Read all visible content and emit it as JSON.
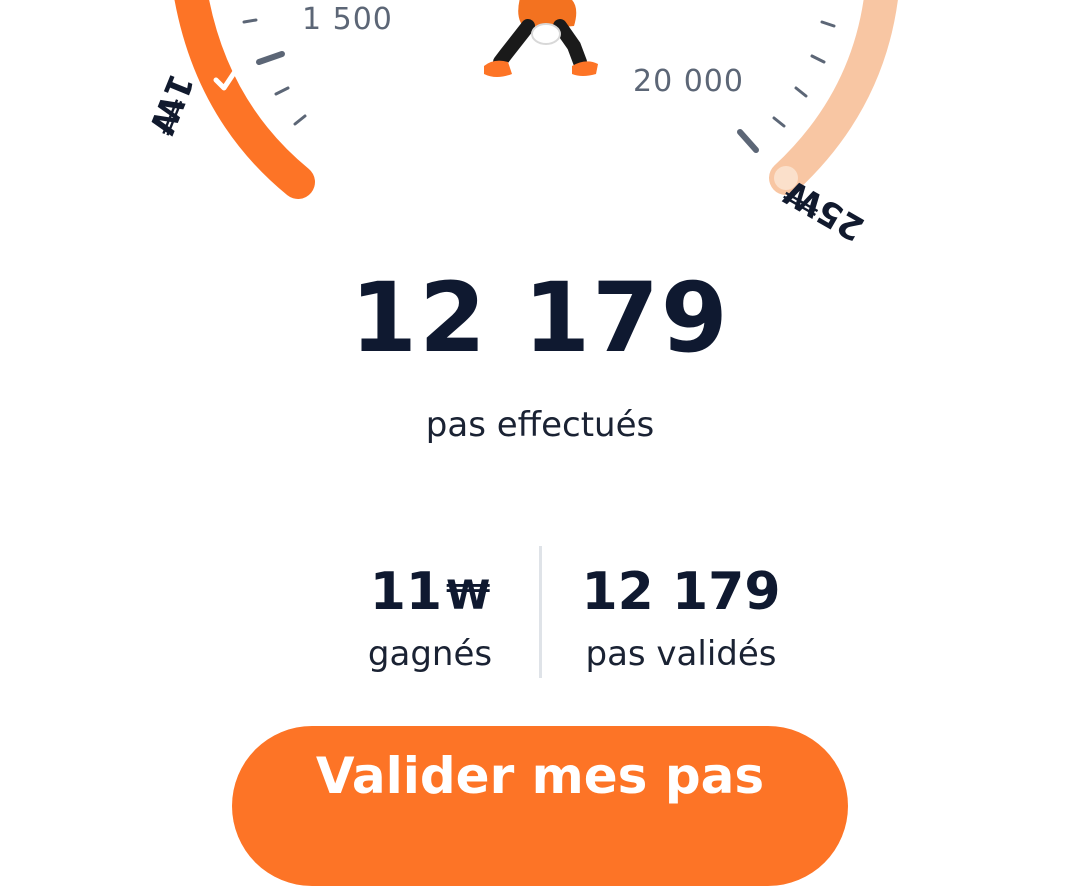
{
  "gauge": {
    "left_arc_label": "1₩",
    "right_arc_label": "25₩",
    "tick_label_left": "1 500",
    "tick_label_right": "20 000",
    "check_icon": "check-icon",
    "mascot_icon": "walking-mascot-icon",
    "colors": {
      "done": "#fd7426",
      "remaining": "#f8c6a3",
      "ticks": "#5c6676"
    }
  },
  "steps": {
    "count": "12 179",
    "caption": "pas effectués"
  },
  "stats": {
    "earned_value": "11",
    "earned_unit": "₩",
    "earned_caption": "gagnés",
    "validated_value": "12 179",
    "validated_caption": "pas validés"
  },
  "cta": {
    "label": "Valider mes pas",
    "color": "#fd7426"
  }
}
